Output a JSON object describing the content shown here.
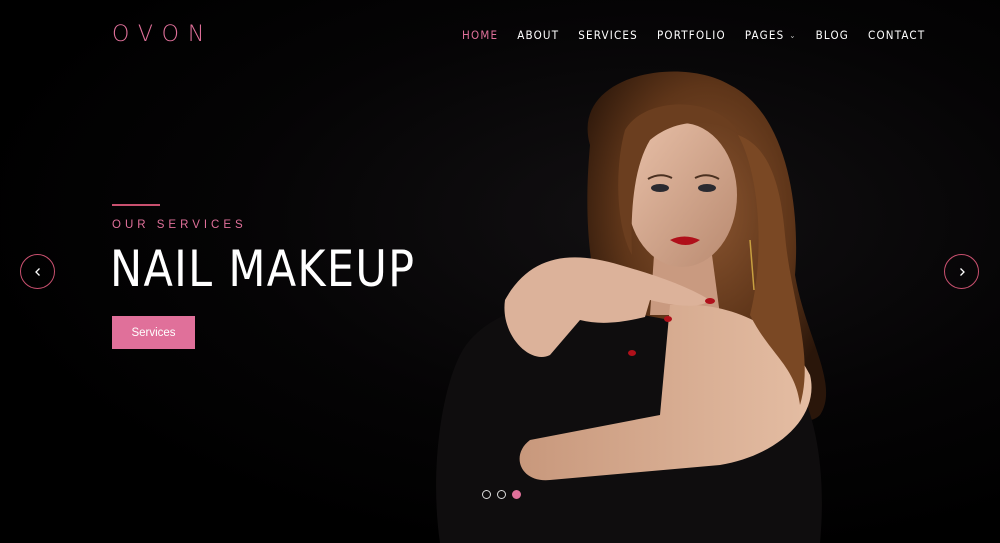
{
  "brand": {
    "logo": "OVON"
  },
  "nav": {
    "items": [
      {
        "label": "HOME",
        "active": true
      },
      {
        "label": "ABOUT"
      },
      {
        "label": "SERVICES"
      },
      {
        "label": "PORTFOLIO"
      },
      {
        "label": "PAGES",
        "has_dropdown": true
      },
      {
        "label": "BLOG"
      },
      {
        "label": "CONTACT"
      }
    ]
  },
  "hero": {
    "eyebrow": "OUR SERVICES",
    "title": "NAIL MAKEUP",
    "button_label": "Services",
    "slides_total": 3,
    "active_slide": 3
  },
  "colors": {
    "accent": "#e0709a",
    "background": "#000000"
  }
}
